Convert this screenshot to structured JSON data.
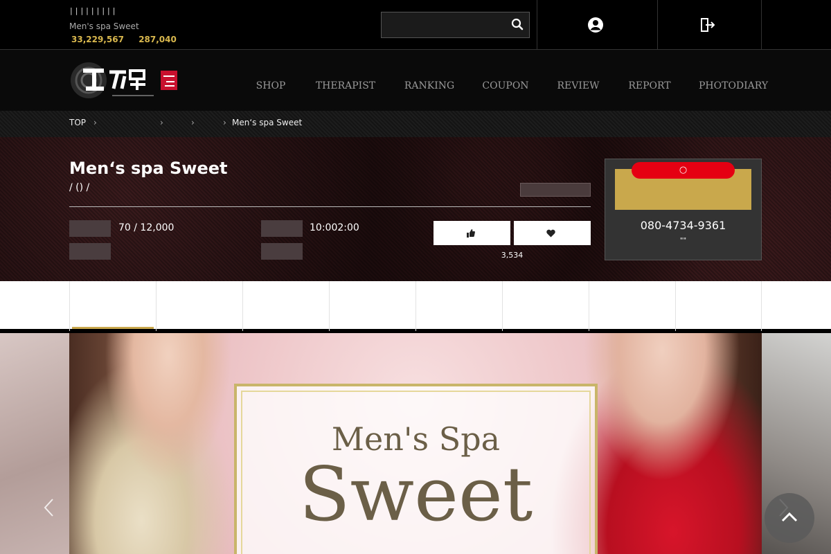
{
  "topbar": {
    "links": [
      "|",
      "",
      "|",
      "",
      "|",
      "",
      "|",
      "",
      "|",
      "",
      "|",
      "",
      "|",
      "",
      "|",
      "",
      "|"
    ],
    "site_name": "Men's spa Sweet",
    "stats": {
      "label1": "",
      "value1": "33,229,567",
      "unit1": "",
      "label2": "",
      "value2": "287,040",
      "unit2": ""
    },
    "search_placeholder": "",
    "login_label": "",
    "register_label": ""
  },
  "nav": [
    {
      "jp": "",
      "en": "SHOP"
    },
    {
      "jp": "",
      "en": "THERAPIST"
    },
    {
      "jp": "",
      "en": "RANKING"
    },
    {
      "jp": "",
      "en": "COUPON"
    },
    {
      "jp": "",
      "en": "REVIEW"
    },
    {
      "jp": "",
      "en": "REPORT"
    },
    {
      "jp": "",
      "en": "PHOTODIARY"
    }
  ],
  "breadcrumb": [
    "TOP",
    "",
    "",
    "",
    "Men‘s spa Sweet"
  ],
  "breadcrumb_sep": "›",
  "shop": {
    "title": "Men‘s spa Sweet",
    "area": " /  () / ",
    "badge": "",
    "info": [
      {
        "label": "",
        "value": "70 / 12,000"
      },
      {
        "label": "",
        "value": "10:002:00"
      },
      {
        "label": "",
        "value": ""
      },
      {
        "label": "",
        "value": ""
      }
    ],
    "like_label": "",
    "fav_label": "",
    "fav_count": "3,534"
  },
  "call": {
    "status": "○ ",
    "button": "",
    "phone": "080-4734-9361",
    "note": "\"\""
  },
  "tabs": [
    "",
    "",
    "",
    "",
    "",
    "",
    "",
    ""
  ],
  "banner": {
    "line1": "Men's Spa",
    "line2": "Sweet"
  },
  "colors": {
    "gold": "#c9a84c",
    "red": "#e50012",
    "dark": "#000000"
  }
}
